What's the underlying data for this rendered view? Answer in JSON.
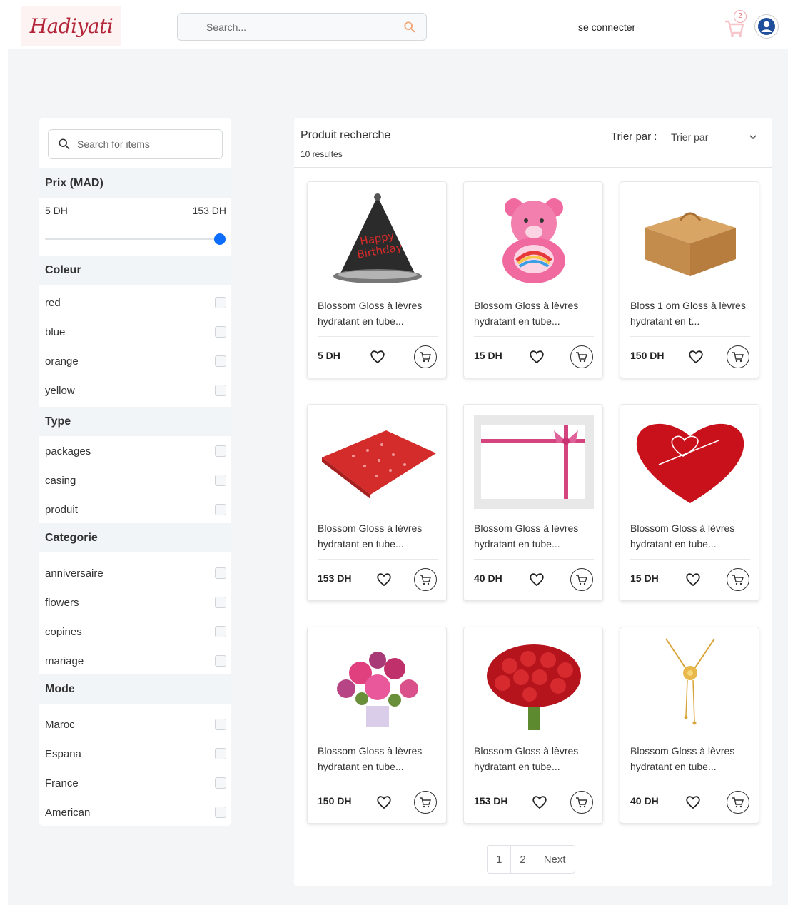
{
  "header": {
    "logo_text": "Hadiyati",
    "search_placeholder": "Search...",
    "login_label": "se connecter",
    "cart_count": "2"
  },
  "sidebar": {
    "search_placeholder": "Search for items",
    "price": {
      "title": "Prix (MAD)",
      "min_label": "5 DH",
      "max_label": "153 DH",
      "slider_value_fraction": 1.0
    },
    "colour": {
      "title": "Coleur",
      "items": [
        "red",
        "blue",
        "orange",
        "yellow"
      ]
    },
    "type": {
      "title": "Type",
      "items": [
        "packages",
        "casing",
        "produit"
      ]
    },
    "categorie": {
      "title": "Categorie",
      "items": [
        "anniversaire",
        "flowers",
        "copines",
        "mariage"
      ]
    },
    "mode": {
      "title": "Mode",
      "items": [
        "Maroc",
        "Espana",
        "France",
        "American"
      ]
    }
  },
  "main": {
    "title": "Produit recherche",
    "count": "10 resultes",
    "sort_label": "Trier par :",
    "sort_value": "Trier par",
    "products": [
      {
        "name": "Blossom Gloss à lèvres hydratant en tube...",
        "price": "5 DH",
        "image": "party-hat"
      },
      {
        "name": "Blossom Gloss à lèvres hydratant en tube...",
        "price": "15 DH",
        "image": "pink-bear"
      },
      {
        "name": "Bloss 1 om Gloss à lèvres hydratant en t...",
        "price": "150 DH",
        "image": "kraft-box"
      },
      {
        "name": "Blossom Gloss à lèvres hydratant en tube...",
        "price": "153 DH",
        "image": "red-wrap"
      },
      {
        "name": "Blossom Gloss à lèvres hydratant en tube...",
        "price": "40 DH",
        "image": "ribbon-card"
      },
      {
        "name": "Blossom Gloss à lèvres hydratant en tube...",
        "price": "15 DH",
        "image": "heart-balloon"
      },
      {
        "name": "Blossom Gloss à lèvres hydratant en tube...",
        "price": "150 DH",
        "image": "flower-bouquet"
      },
      {
        "name": "Blossom Gloss à lèvres hydratant en tube...",
        "price": "153 DH",
        "image": "red-roses"
      },
      {
        "name": "Blossom Gloss à lèvres hydratant en tube...",
        "price": "40 DH",
        "image": "gold-necklace"
      }
    ],
    "pagination": [
      "1",
      "2",
      "Next"
    ]
  },
  "colors": {
    "accent": "#0d6efd",
    "logo": "#b3263a",
    "page_bg": "#f4f5f6",
    "section_bg": "#f1f5f7"
  }
}
